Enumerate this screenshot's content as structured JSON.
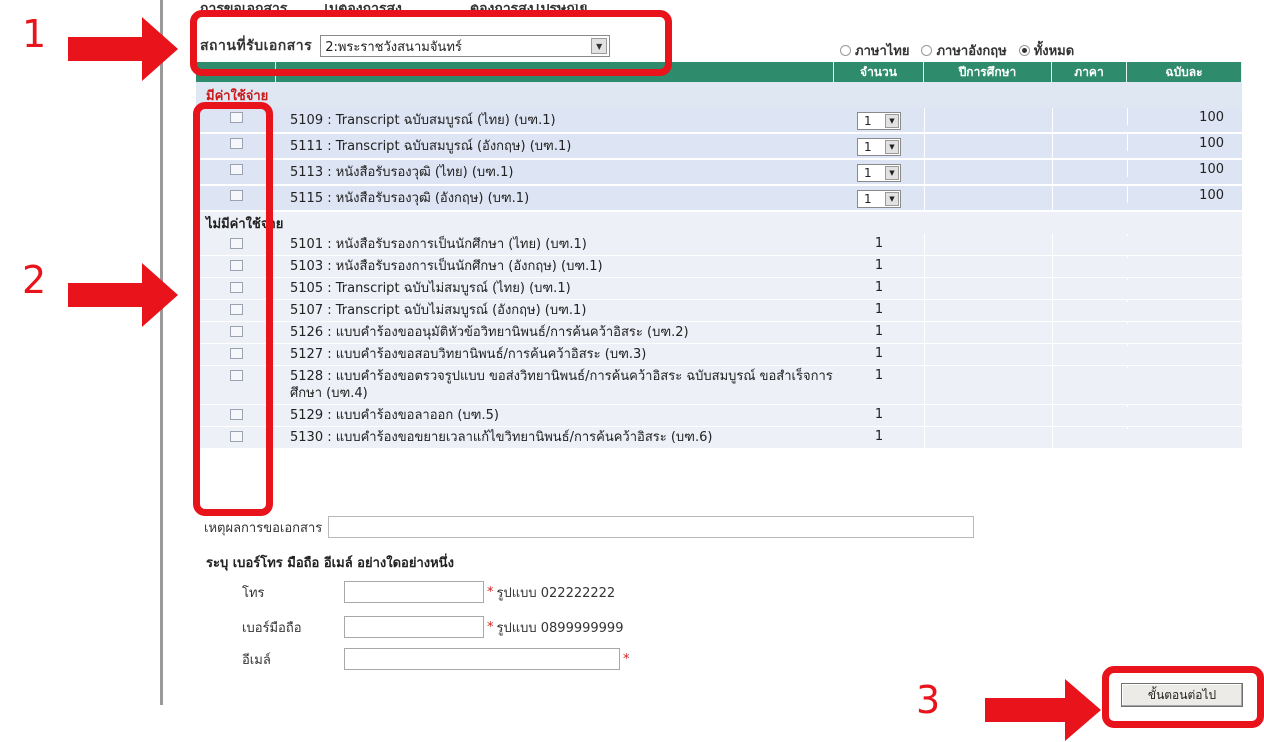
{
  "top_partial": {
    "doc_type_label": "การขอเอกสาร",
    "opt1": "ไม่ต้องการส่ง",
    "opt2": "ต้องการส่งไปรษณีย์"
  },
  "pickup": {
    "label": "สถานที่รับเอกสาร",
    "selected": "2:พระราชวังสนามจันทร์"
  },
  "language": {
    "thai": "ภาษาไทย",
    "english": "ภาษาอังกฤษ",
    "all": "ทั้งหมด",
    "selected": "all"
  },
  "table": {
    "headers": [
      "จำนวน",
      "ปีการศึกษา",
      "ภาคา",
      "ฉบับละ"
    ],
    "paid_section": "มีค่าใช้จ่าย",
    "free_section": "ไม่มีค่าใช้จ่าย",
    "paid_items": [
      {
        "name": "5109 : Transcript ฉบับสมบูรณ์ (ไทย) (บฑ.1)",
        "qty": "1",
        "price": "100"
      },
      {
        "name": "5111 : Transcript ฉบับสมบูรณ์ (อังกฤษ) (บฑ.1)",
        "qty": "1",
        "price": "100"
      },
      {
        "name": "5113 : หนังสือรับรองวุฒิ (ไทย) (บฑ.1)",
        "qty": "1",
        "price": "100"
      },
      {
        "name": "5115 : หนังสือรับรองวุฒิ (อังกฤษ) (บฑ.1)",
        "qty": "1",
        "price": "100"
      }
    ],
    "free_items": [
      {
        "name": "5101 : หนังสือรับรองการเป็นนักศึกษา (ไทย) (บฑ.1)",
        "qty": "1"
      },
      {
        "name": "5103 : หนังสือรับรองการเป็นนักศึกษา (อังกฤษ) (บฑ.1)",
        "qty": "1"
      },
      {
        "name": "5105 : Transcript ฉบับไม่สมบูรณ์ (ไทย) (บฑ.1)",
        "qty": "1"
      },
      {
        "name": "5107 : Transcript ฉบับไม่สมบูรณ์ (อังกฤษ) (บฑ.1)",
        "qty": "1"
      },
      {
        "name": "5126 : แบบคำร้องขออนุมัติหัวข้อวิทยานิพนธ์/การค้นคว้าอิสระ (บฑ.2)",
        "qty": "1"
      },
      {
        "name": "5127 : แบบคำร้องขอสอบวิทยานิพนธ์/การค้นคว้าอิสระ (บฑ.3)",
        "qty": "1"
      },
      {
        "name": "5128 : แบบคำร้องขอตรวจรูปแบบ ขอส่งวิทยานิพนธ์/การค้นคว้าอิสระ ฉบับสมบูรณ์ ขอสำเร็จการศึกษา (บฑ.4)",
        "qty": "1"
      },
      {
        "name": "5129 : แบบคำร้องขอลาออก (บฑ.5)",
        "qty": "1"
      },
      {
        "name": "5130 : แบบคำร้องขอขยายเวลาแก้ไขวิทยานิพนธ์/การค้นคว้าอิสระ (บฑ.6)",
        "qty": "1"
      }
    ]
  },
  "reason": {
    "label": "เหตุผลการขอเอกสาร",
    "value": ""
  },
  "contact": {
    "title": "ระบุ เบอร์โทร มือถือ อีเมล์ อย่างใดอย่างหนึ่ง",
    "phone_label": "โทร",
    "phone_format": "รูปแบบ 022222222",
    "mobile_label": "เบอร์มือถือ",
    "mobile_format": "รูปแบบ 0899999999",
    "email_label": "อีเมล์",
    "required_mark": "*"
  },
  "next_button": "ขั้นตอนต่อไป",
  "callouts": {
    "n1": "1",
    "n2": "2",
    "n3": "3"
  },
  "colors": {
    "header_green": "#2e8b6b",
    "callout_red": "#e8131b",
    "paid_red": "#cc1a1a"
  }
}
